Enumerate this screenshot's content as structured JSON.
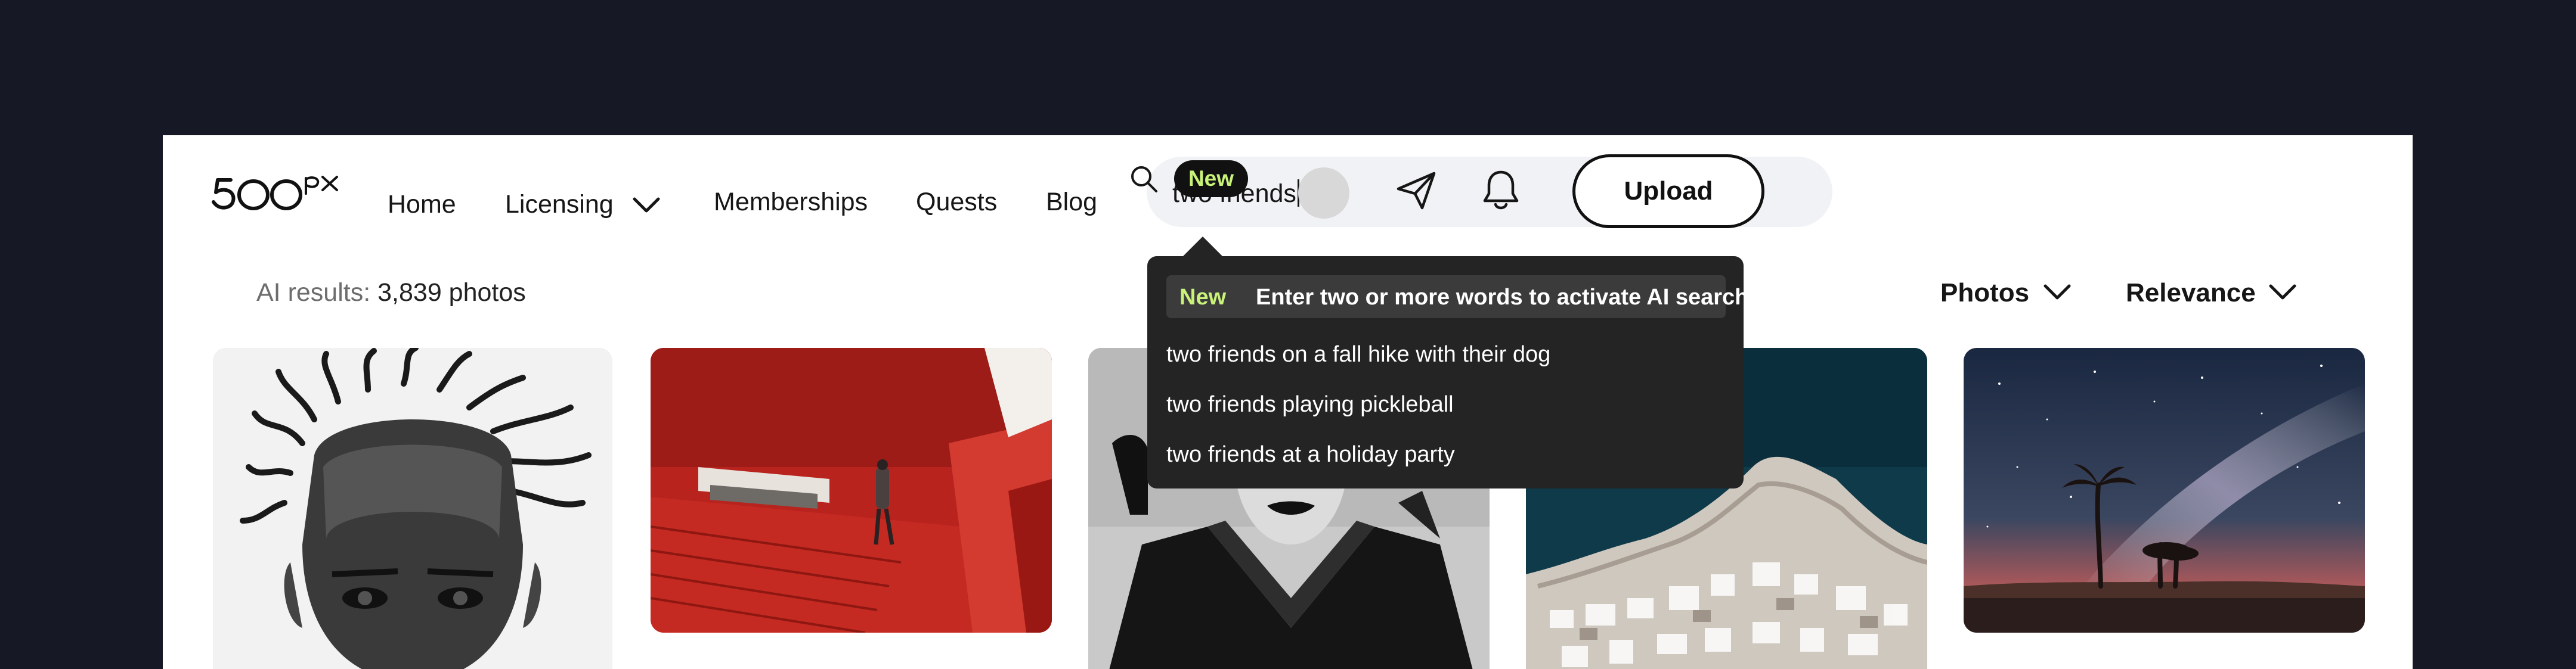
{
  "header": {
    "logo_text": "500px",
    "nav": [
      {
        "label": "Home"
      },
      {
        "label": "Licensing"
      },
      {
        "label": "Memberships"
      },
      {
        "label": "Quests"
      },
      {
        "label": "Blog"
      }
    ],
    "search": {
      "value": "two friends",
      "badge": "New"
    },
    "upload_label": "Upload"
  },
  "search_dropdown": {
    "hint_badge": "New",
    "hint_text": "Enter two or more words to activate AI search",
    "suggestions": [
      "two friends on a fall hike with their dog",
      "two friends playing pickleball",
      "two friends at a holiday party"
    ]
  },
  "results": {
    "prefix": "AI results:",
    "count": "3,839 photos"
  },
  "filters": {
    "type": "Photos",
    "sort": "Relevance"
  },
  "photos": [
    {
      "subject": "black-and-white portrait of man with dreadlocks"
    },
    {
      "subject": "red staircase architecture with person"
    },
    {
      "subject": "black-and-white fashion portrait of woman"
    },
    {
      "subject": "aerial view of coastal town"
    },
    {
      "subject": "milky way over palm trees at night"
    }
  ],
  "colors": {
    "page_bg": "#171826",
    "accent_new": "#c9f27a",
    "dropdown_bg": "#242424"
  }
}
